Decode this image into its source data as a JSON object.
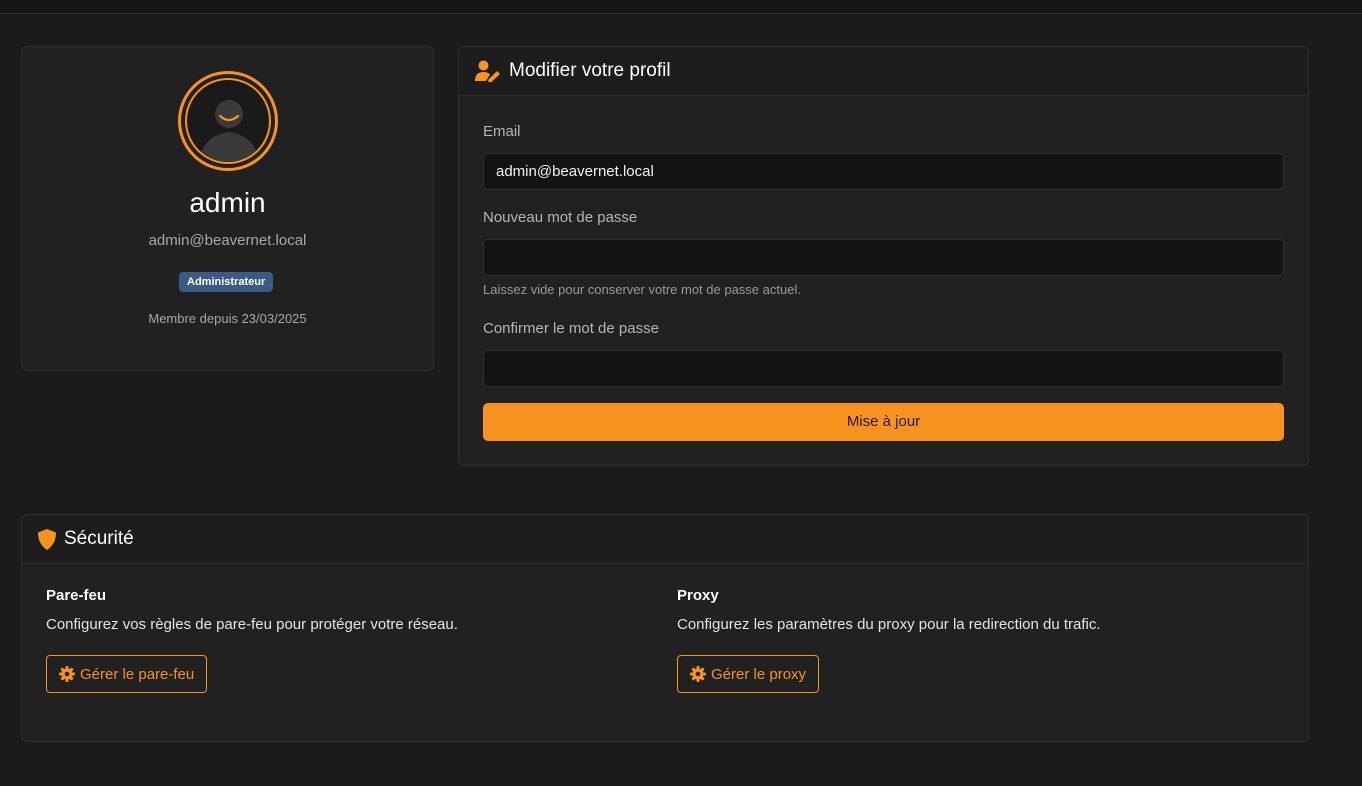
{
  "profile": {
    "username": "admin",
    "email": "admin@beavernet.local",
    "role": "Administrateur",
    "member_since": "Membre depuis 23/03/2025",
    "avatar_icon": "user-avatar-icon"
  },
  "edit_profile": {
    "title": "Modifier votre profil",
    "icon": "user-edit-icon",
    "email_label": "Email",
    "email_value": "admin@beavernet.local",
    "new_password_label": "Nouveau mot de passe",
    "new_password_value": "",
    "new_password_help": "Laissez vide pour conserver votre mot de passe actuel.",
    "confirm_password_label": "Confirmer le mot de passe",
    "confirm_password_value": "",
    "submit_label": "Mise à jour"
  },
  "security": {
    "title": "Sécurité",
    "icon": "shield-icon",
    "firewall": {
      "title": "Pare-feu",
      "description": "Configurez vos règles de pare-feu pour protéger votre réseau.",
      "button_label": "Gérer le pare-feu",
      "button_icon": "gear-icon"
    },
    "proxy": {
      "title": "Proxy",
      "description": "Configurez les paramètres du proxy pour la redirection du trafic.",
      "button_label": "Gérer le proxy",
      "button_icon": "gear-icon"
    }
  },
  "colors": {
    "accent": "#f7931e",
    "background": "#1b1b1b",
    "card": "#212121",
    "badge": "#3a5b86"
  }
}
